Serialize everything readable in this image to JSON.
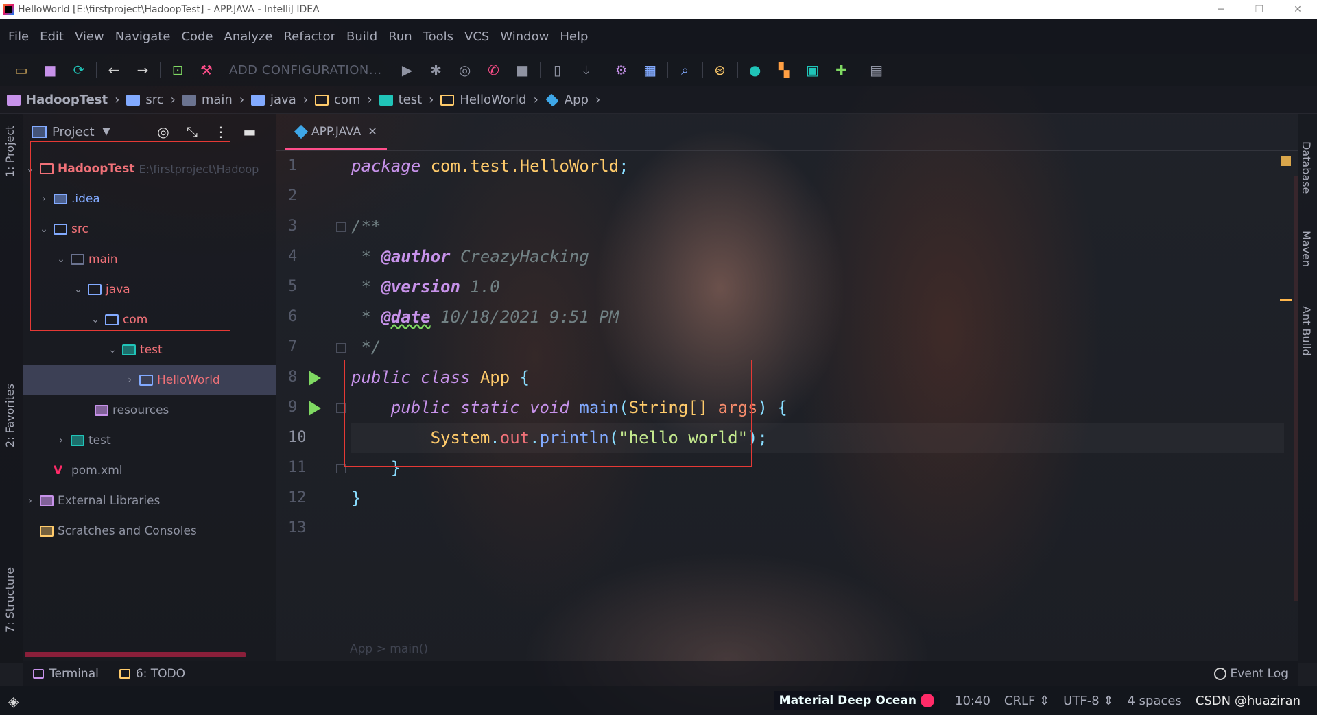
{
  "window": {
    "title": "HelloWorld [E:\\firstproject\\HadoopTest] - APP.JAVA - IntelliJ IDEA",
    "minimize": "─",
    "restore": "❐",
    "close": "✕"
  },
  "menu": [
    "File",
    "Edit",
    "View",
    "Navigate",
    "Code",
    "Analyze",
    "Refactor",
    "Build",
    "Run",
    "Tools",
    "VCS",
    "Window",
    "Help"
  ],
  "toolbar": {
    "config_label": "ADD CONFIGURATION...",
    "icons": [
      "open-folder",
      "save",
      "sync",
      "back",
      "forward",
      "terminal",
      "build-hammer",
      "run",
      "debug",
      "coverage",
      "profile",
      "stop",
      "bookmark",
      "download",
      "settings",
      "structure",
      "search",
      "plugin",
      "vcs",
      "layout",
      "tool-window",
      "puzzle",
      "presentation"
    ]
  },
  "breadcrumb": [
    {
      "label": "HadoopTest",
      "icon": "module-icon"
    },
    {
      "label": "src",
      "icon": "source-folder-icon"
    },
    {
      "label": "main",
      "icon": "folder-icon"
    },
    {
      "label": "java",
      "icon": "folder-icon"
    },
    {
      "label": "com",
      "icon": "package-icon"
    },
    {
      "label": "test",
      "icon": "test-folder-icon"
    },
    {
      "label": "HelloWorld",
      "icon": "package-icon"
    },
    {
      "label": "App",
      "icon": "class-icon"
    }
  ],
  "left_stripe": {
    "project_tab": "1: Project",
    "favorites_tab": "2: Favorites",
    "structure_tab": "7: Structure"
  },
  "right_stripe": {
    "database_tab": "Database",
    "maven_tab": "Maven",
    "ant_tab": "Ant Build"
  },
  "project_panel": {
    "title": "Project",
    "tree": [
      {
        "label": "HadoopTest",
        "path": "E:\\firstproject\\Hadoop",
        "level": 0,
        "arrow": "⌄",
        "color": "#f07178"
      },
      {
        "label": ".idea",
        "level": 1,
        "arrow": "›",
        "color": "#82aaff"
      },
      {
        "label": "src",
        "level": 1,
        "arrow": "⌄",
        "color": "#f07178"
      },
      {
        "label": "main",
        "level": 2,
        "arrow": "⌄",
        "color": "#f07178"
      },
      {
        "label": "java",
        "level": 3,
        "arrow": "⌄",
        "color": "#f07178"
      },
      {
        "label": "com",
        "level": 4,
        "arrow": "⌄",
        "color": "#f07178"
      },
      {
        "label": "test",
        "level": 5,
        "arrow": "⌄",
        "color": "#f07178"
      },
      {
        "label": "HelloWorld",
        "level": 6,
        "arrow": "›",
        "color": "#f07178",
        "selected": true
      },
      {
        "label": "resources",
        "level": 3,
        "arrow": "",
        "color": "#8f93a2"
      },
      {
        "label": "test",
        "level": 2,
        "arrow": "›",
        "color": "#8f93a2"
      },
      {
        "label": "pom.xml",
        "level": 1,
        "arrow": "",
        "color": "#8f93a2"
      },
      {
        "label": "External Libraries",
        "level": 0,
        "arrow": "›",
        "color": "#8f93a2"
      },
      {
        "label": "Scratches and Consoles",
        "level": 0,
        "arrow": "",
        "color": "#8f93a2"
      }
    ]
  },
  "editor": {
    "tab_label": "APP.JAVA",
    "line_numbers": [
      "1",
      "2",
      "3",
      "4",
      "5",
      "6",
      "7",
      "8",
      "9",
      "10",
      "11",
      "12",
      "13"
    ],
    "current_line": "10",
    "code": {
      "pkg_kw": "package",
      "pkg_name": "com.test.HelloWorld",
      "doc_open": "/**",
      "author_tag": "@author",
      "author_val": "CreazyHacking",
      "version_tag": "@version",
      "version_val": "1.0",
      "date_tag": "@date",
      "date_val": "10/18/2021 9:51 PM",
      "doc_close": "*/",
      "class_decl": "public class",
      "class_name": "App",
      "method_mods": "public static void",
      "method_name": "main",
      "param_type": "String[]",
      "param_name": "args",
      "sys": "System",
      "out": "out",
      "println": "println",
      "str": "\"hello world\""
    },
    "breadcrumb_footer": "App  >  main()"
  },
  "bottom_tools": {
    "terminal": "Terminal",
    "todo": "6: TODO",
    "event_log": "Event Log"
  },
  "status": {
    "theme": "Material Deep Ocean",
    "position": "10:40",
    "line_sep": "CRLF ⇕",
    "encoding": "UTF-8 ⇕",
    "indent": "4 spaces",
    "watermark": "CSDN @huaziran"
  },
  "colors": {
    "accent": "#ff4e8a",
    "run_green": "#7fd962",
    "highlight_box": "#e53935"
  }
}
